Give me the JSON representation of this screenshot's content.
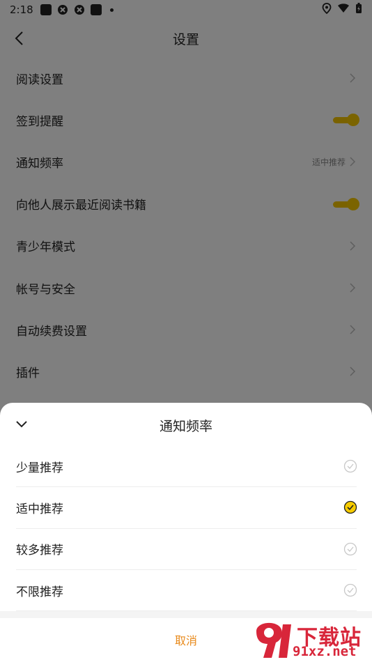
{
  "status_bar": {
    "time": "2:18"
  },
  "header": {
    "title": "设置"
  },
  "settings": [
    {
      "label": "阅读设置",
      "type": "link"
    },
    {
      "label": "签到提醒",
      "type": "toggle",
      "on": true
    },
    {
      "label": "通知频率",
      "type": "link",
      "value": "适中推荐"
    },
    {
      "label": "向他人展示最近阅读书籍",
      "type": "toggle",
      "on": true
    },
    {
      "label": "青少年模式",
      "type": "link"
    },
    {
      "label": "帐号与安全",
      "type": "link"
    },
    {
      "label": "自动续费设置",
      "type": "link"
    },
    {
      "label": "插件",
      "type": "link"
    }
  ],
  "sheet": {
    "title": "通知频率",
    "options": [
      {
        "label": "少量推荐",
        "selected": false
      },
      {
        "label": "适中推荐",
        "selected": true
      },
      {
        "label": "较多推荐",
        "selected": false
      },
      {
        "label": "不限推荐",
        "selected": false
      }
    ],
    "cancel_label": "取消"
  },
  "watermark": {
    "text": "下载站",
    "sub": "91xz.net"
  },
  "colors": {
    "accent": "#f5c400",
    "cancel": "#e8891a",
    "watermark": "#d8263a"
  }
}
